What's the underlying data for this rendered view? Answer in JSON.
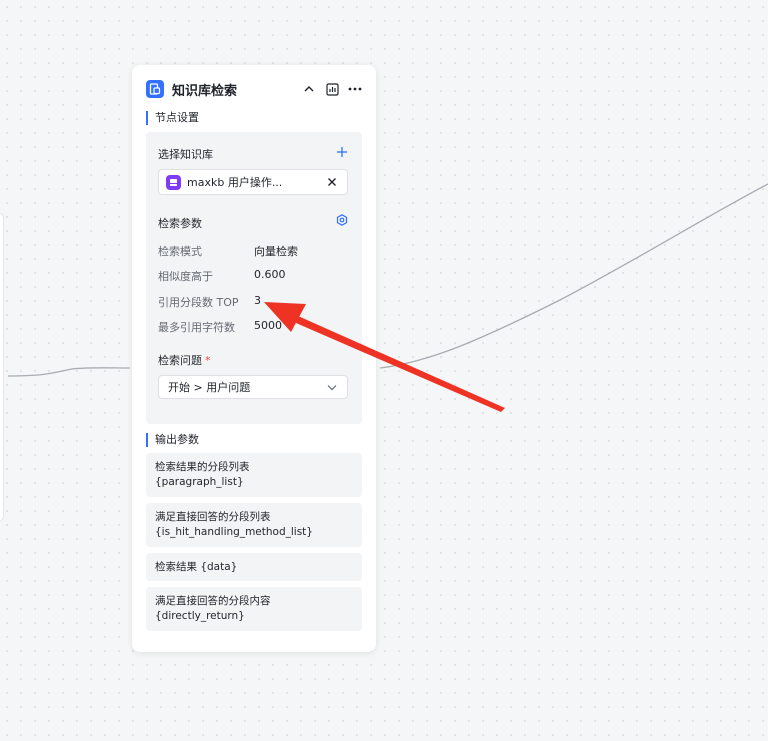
{
  "node": {
    "title": "知识库检索",
    "settings_label": "节点设置",
    "knowledge": {
      "label": "选择知识库",
      "items": [
        {
          "name": "maxkb 用户操作..."
        }
      ]
    },
    "search_params": {
      "label": "检索参数",
      "rows": [
        {
          "label": "检索模式",
          "value": "向量检索"
        },
        {
          "label": "相似度高于",
          "value": "0.600"
        },
        {
          "label": "引用分段数 TOP",
          "value": "3"
        },
        {
          "label": "最多引用字符数",
          "value": "5000"
        }
      ]
    },
    "question": {
      "label": "检索问题",
      "required_mark": "*",
      "value": "开始 > 用户问题"
    },
    "output_label": "输出参数",
    "outputs": [
      {
        "name": "检索结果的分段列表",
        "var": "{paragraph_list}"
      },
      {
        "name": "满足直接回答的分段列表",
        "var": "{is_hit_handling_method_list}"
      },
      {
        "name": "检索结果 {data}",
        "var": ""
      },
      {
        "name": "满足直接回答的分段内容",
        "var": "{directly_return}"
      }
    ]
  },
  "colors": {
    "accent": "#3370ff",
    "kb_icon": "#7f3bf5",
    "annotation_arrow": "#ee3324",
    "edge": "#a8acb2"
  },
  "icons": {
    "node": "knowledge-base-icon",
    "collapse": "chevron-up-icon",
    "chart": "chart-icon",
    "more": "more-icon",
    "add": "plus-icon",
    "kb": "dataset-icon",
    "close": "close-icon",
    "settings": "gear-icon",
    "caret": "chevron-down-icon"
  }
}
